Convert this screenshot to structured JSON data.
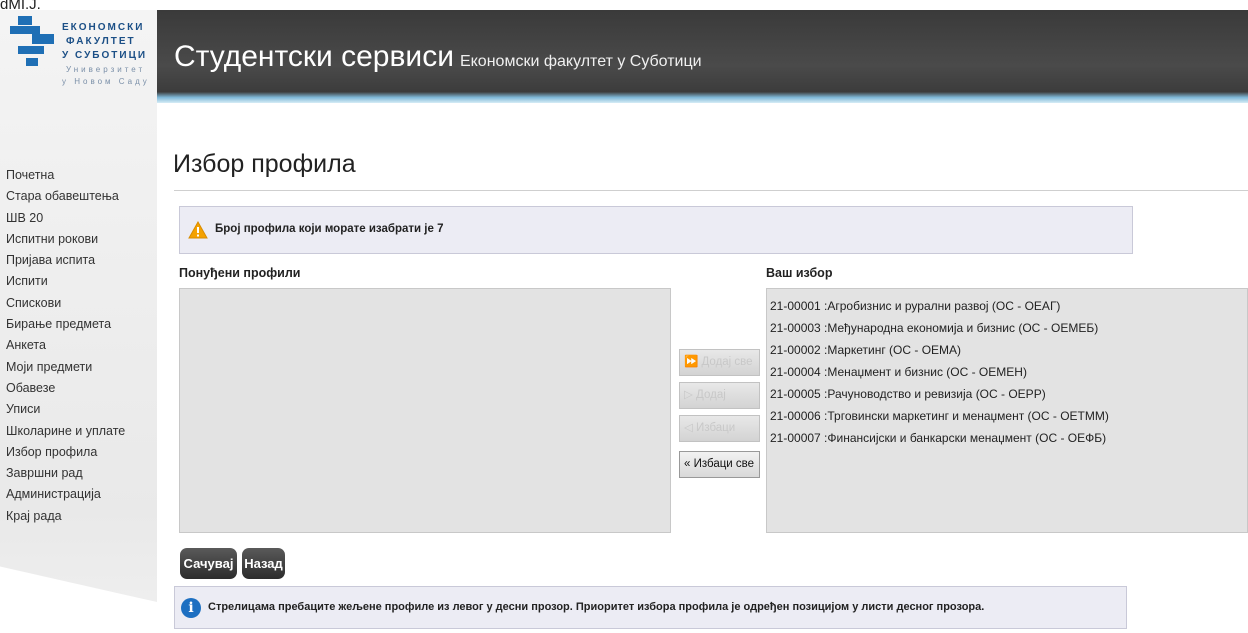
{
  "top_cut_text": "dMI.J.",
  "logo": {
    "line1": "ЕКОНОМСКИ",
    "line2": "ФАКУЛТЕТ",
    "line3": "У СУБОТИЦИ",
    "line4": "Универзитет",
    "line5": "у Новом Саду"
  },
  "header": {
    "title": "Студентски сервиси",
    "subtitle": "Економски факултет у Суботици"
  },
  "nav": {
    "items": [
      "Почетна",
      "Стара обавештења",
      "ШВ 20",
      "Испитни рокови",
      "Пријава испита",
      "Испити",
      "Спискови",
      "Бирање предмета",
      "Анкета",
      "Моји предмети",
      "Обавезе",
      "Уписи",
      "Школарине и уплате",
      "Избор профила",
      "Завршни рад",
      "Администрација",
      "Крај рада"
    ]
  },
  "page_title": "Избор профила",
  "alert": {
    "text": "Број профила који морате изабрати је 7"
  },
  "left_panel": {
    "label": "Понуђени профили"
  },
  "right_panel": {
    "label": "Ваш избор",
    "items": [
      "21-00001 :Агробизнис и рурални развој (ОС - ОЕАГ)",
      "21-00003 :Међународна економија и бизнис (ОС - ОЕМЕБ)",
      "21-00002 :Маркетинг (ОС - ОЕМА)",
      "21-00004 :Менаџмент и бизнис (ОС - ОЕМЕН)",
      "21-00005 :Рачуноводство и ревизија (ОС - ОЕРР)",
      "21-00006 :Трговински маркетинг и менаџмент (ОС - ОЕТММ)",
      "21-00007 :Финансијски и банкарски менаџмент (ОС - ОЕФБ)"
    ]
  },
  "transfer": {
    "add_all": "Додај све",
    "add": "Додај",
    "remove": "Избаци",
    "remove_all": "« Избаци све"
  },
  "buttons": {
    "save": "Сачувај",
    "back": "Назад"
  },
  "info": {
    "text": "Стрелицама пребаците жељене профиле из левог у десни прозор. Приоритет избора профила је одређен позицијом у листи десног прозора."
  },
  "icons": {
    "warning": "warning-icon",
    "info": "info-icon"
  }
}
